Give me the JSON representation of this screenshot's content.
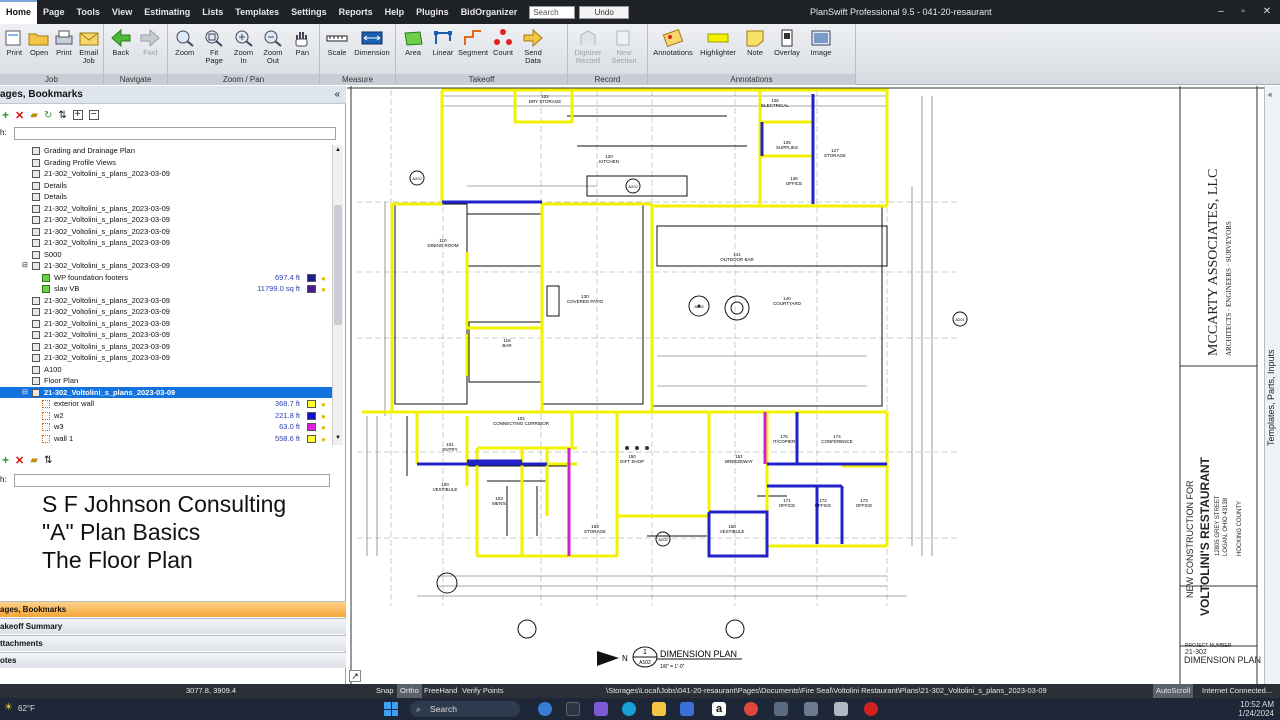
{
  "menubar": {
    "items": [
      "Home",
      "Page",
      "Tools",
      "View",
      "Estimating",
      "Lists",
      "Templates",
      "Settings",
      "Reports",
      "Help",
      "Plugins",
      "BidOrganizer"
    ],
    "search_placeholder": "Search",
    "undo_label": "Undo",
    "window_title": "PlanSwift Professional 9.5 - 041-20-resaurant",
    "minimize": "–",
    "maximize": "▫",
    "close": "✕"
  },
  "ribbon": {
    "groups": [
      {
        "label": "Job",
        "buttons": [
          {
            "label": "Print",
            "sub": ""
          },
          {
            "label": "Open",
            "sub": ""
          },
          {
            "label": "Print",
            "sub": ""
          },
          {
            "label": "Email",
            "sub": "Job"
          }
        ]
      },
      {
        "label": "Navigate",
        "buttons": [
          {
            "label": "Back",
            "sub": ""
          },
          {
            "label": "Fwd",
            "sub": ""
          }
        ]
      },
      {
        "label": "Zoom / Pan",
        "buttons": [
          {
            "label": "Zoom",
            "sub": ""
          },
          {
            "label": "Fit",
            "sub": "Page"
          },
          {
            "label": "Zoom",
            "sub": "In"
          },
          {
            "label": "Zoom",
            "sub": "Out"
          },
          {
            "label": "Pan",
            "sub": ""
          }
        ]
      },
      {
        "label": "Measure",
        "buttons": [
          {
            "label": "Scale",
            "sub": ""
          },
          {
            "label": "Dimension",
            "sub": ""
          }
        ]
      },
      {
        "label": "Takeoff",
        "buttons": [
          {
            "label": "Area",
            "sub": ""
          },
          {
            "label": "Linear",
            "sub": ""
          },
          {
            "label": "Segment",
            "sub": ""
          },
          {
            "label": "Count",
            "sub": ""
          },
          {
            "label": "Send",
            "sub": "Data"
          }
        ]
      },
      {
        "label": "Record",
        "buttons": [
          {
            "label": "Digitizer",
            "sub": "Record"
          },
          {
            "label": "New",
            "sub": "Section"
          }
        ]
      },
      {
        "label": "Annotations",
        "buttons": [
          {
            "label": "Annotations",
            "sub": ""
          },
          {
            "label": "Highlighter",
            "sub": ""
          },
          {
            "label": "Note",
            "sub": ""
          },
          {
            "label": "Overlay",
            "sub": ""
          },
          {
            "label": "Image",
            "sub": ""
          }
        ]
      }
    ]
  },
  "leftpanel": {
    "header": "ages, Bookmarks",
    "search_label": "h:",
    "tree": [
      {
        "name": "Grading and Drainage Plan",
        "indent": 1,
        "icon": "page"
      },
      {
        "name": "Grading Profile Views",
        "indent": 1,
        "icon": "page"
      },
      {
        "name": "21-302_Voltolini_s_plans_2023-03-09",
        "indent": 1,
        "icon": "page"
      },
      {
        "name": "Details",
        "indent": 1,
        "icon": "page"
      },
      {
        "name": "Details",
        "indent": 1,
        "icon": "page"
      },
      {
        "name": "21-302_Voltolini_s_plans_2023-03-09",
        "indent": 1,
        "icon": "page"
      },
      {
        "name": "21-302_Voltolini_s_plans_2023-03-09",
        "indent": 1,
        "icon": "page"
      },
      {
        "name": "21-302_Voltolini_s_plans_2023-03-09",
        "indent": 1,
        "icon": "page"
      },
      {
        "name": "21-302_Voltolini_s_plans_2023-03-09",
        "indent": 1,
        "icon": "page"
      },
      {
        "name": "S000",
        "indent": 1,
        "icon": "page"
      },
      {
        "name": "21-302_Voltolini_s_plans_2023-03-09",
        "indent": 1,
        "icon": "page",
        "expanded": true
      },
      {
        "name": "WP foundation footers",
        "indent": 2,
        "icon": "area",
        "value": "697.4 ft",
        "swatch": "#1d1d8c"
      },
      {
        "name": "slav VB",
        "indent": 2,
        "icon": "area",
        "value": "11799.0 sq ft",
        "swatch": "#4a1a8a"
      },
      {
        "name": "21-302_Voltolini_s_plans_2023-03-09",
        "indent": 1,
        "icon": "page"
      },
      {
        "name": "21-302_Voltolini_s_plans_2023-03-09",
        "indent": 1,
        "icon": "page"
      },
      {
        "name": "21-302_Voltolini_s_plans_2023-03-09",
        "indent": 1,
        "icon": "page"
      },
      {
        "name": "21-302_Voltolini_s_plans_2023-03-09",
        "indent": 1,
        "icon": "page"
      },
      {
        "name": "21-302_Voltolini_s_plans_2023-03-09",
        "indent": 1,
        "icon": "page"
      },
      {
        "name": "21-302_Voltolini_s_plans_2023-03-09",
        "indent": 1,
        "icon": "page"
      },
      {
        "name": "A100",
        "indent": 1,
        "icon": "page"
      },
      {
        "name": "Floor Plan",
        "indent": 1,
        "icon": "page"
      },
      {
        "name": "21-302_Voltolini_s_plans_2023-03-09",
        "indent": 1,
        "icon": "page",
        "selected": true
      },
      {
        "name": "exterior wall",
        "indent": 2,
        "icon": "linear",
        "value": "368.7 ft",
        "swatch": "#ffff33"
      },
      {
        "name": "w2",
        "indent": 2,
        "icon": "linear",
        "value": "221.8 ft",
        "swatch": "#1010c8"
      },
      {
        "name": "w3",
        "indent": 2,
        "icon": "linear",
        "value": "63.0 ft",
        "swatch": "#e020e0"
      },
      {
        "name": "wall 1",
        "indent": 2,
        "icon": "linear",
        "value": "558.6 ft",
        "swatch": "#ffff33"
      }
    ],
    "lower_search_label": "h:",
    "overlay_lines": [
      "S F Johnson Consulting",
      "\"A\" Plan Basics",
      "The Floor Plan"
    ],
    "accordions": [
      {
        "label": "ages, Bookmarks",
        "active": true
      },
      {
        "label": "akeoff Summary",
        "active": false
      },
      {
        "label": "ttachments",
        "active": false
      },
      {
        "label": "otes",
        "active": false
      }
    ]
  },
  "plan": {
    "rooms": [
      {
        "num": "121",
        "name": "DRY STORAGE"
      },
      {
        "num": "126",
        "name": "ELECTRICAL"
      },
      {
        "num": "125",
        "name": "SUPPLIES"
      },
      {
        "num": "127",
        "name": "STORAGE"
      },
      {
        "num": "120",
        "name": "KITCHEN"
      },
      {
        "num": "136",
        "name": "OFFICE"
      },
      {
        "num": "110",
        "name": "DINING ROOM"
      },
      {
        "num": "141",
        "name": "OUTDOOR BAR"
      },
      {
        "num": "130",
        "name": "COVERED PATIO"
      },
      {
        "num": "140",
        "name": "COURTYARD"
      },
      {
        "num": "115",
        "name": "BAR"
      },
      {
        "num": "102",
        "name": "CONNECTING CORRIDOR"
      },
      {
        "num": "101",
        "name": "ENTRY"
      },
      {
        "num": "150",
        "name": "GIFT SHOP"
      },
      {
        "num": "151",
        "name": "BREEZEWAY"
      },
      {
        "num": "175",
        "name": "IT/COPIER"
      },
      {
        "num": "174",
        "name": "CONFERENCE"
      },
      {
        "num": "100",
        "name": "VESTIBULE"
      },
      {
        "num": "103",
        "name": "MEN'S"
      },
      {
        "num": "153",
        "name": "STORAGE"
      },
      {
        "num": "160",
        "name": "VESTIBULE"
      },
      {
        "num": "171",
        "name": "OFFICE"
      },
      {
        "num": "172",
        "name": "OFFICE"
      },
      {
        "num": "173",
        "name": "OFFICE"
      }
    ],
    "title_block": {
      "firm": "MCCARTY ASSOCIATES, LLC",
      "firm_sub": "ARCHITECTS · ENGINEERS · SURVEYORS",
      "project_label": "NEW CONSTRUCTION FOR",
      "project_name": "VOLTOLINI'S RESTAURANT",
      "address1": "12805 GREY STREET",
      "address2": "LOGAN, OHIO 43138",
      "county": "HOCKING COUNTY",
      "project_number_label": "PROJECT NUMBER",
      "project_number": "21-302",
      "sheet_title": "DIMENSION PLAN"
    },
    "plan_title": "DIMENSION PLAN",
    "plan_title_num": "1",
    "plan_title_sheet": "A102",
    "plan_scale": "1/8\" = 1'-0\"",
    "north": "N",
    "ref_tags": [
      "A202",
      "A202",
      "A201",
      "A202",
      "A202"
    ]
  },
  "rightdock": {
    "label": "Templates, Parts, Inputs"
  },
  "statusbar": {
    "coords": "3077.8, 3909.4",
    "toggles": [
      {
        "label": "Snap",
        "on": false
      },
      {
        "label": "Ortho",
        "on": true
      },
      {
        "label": "FreeHand",
        "on": false
      },
      {
        "label": "Verify Points",
        "on": false
      }
    ],
    "path": "\\Storages\\Local\\Jobs\\041-20-resaurant\\Pages\\Documents\\Fire Seal\\Voltolini Restaurant\\Plans\\21-302_Voltolini_s_plans_2023-03-09",
    "autoscroll": "AutoScroll",
    "connection": "Internet Connected..."
  },
  "taskbar": {
    "temp": "62°F",
    "search_label": "Search",
    "time": "10:52 AM",
    "date": "1/24/2024"
  },
  "colors": {
    "yellow_wall": "#f2f200",
    "blue_wall": "#2222c8",
    "magenta_wall": "#d020d0",
    "selection": "#1273de",
    "active_accordion": "#f4a436"
  }
}
